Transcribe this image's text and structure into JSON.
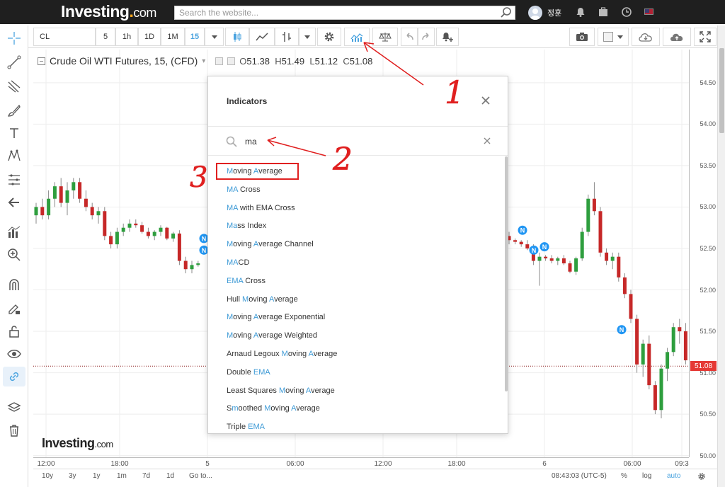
{
  "site": {
    "logo_main": "Investing",
    "logo_dot": ".",
    "logo_com": "com",
    "search_placeholder": "Search the website...",
    "username": "정훈"
  },
  "toolbar": {
    "symbol": "CL",
    "intervals": [
      "5",
      "1h",
      "1D",
      "1M",
      "15"
    ],
    "active_interval": "15"
  },
  "legend": {
    "title": "Crude Oil WTI Futures, 15, (CFD)",
    "open_label": "O",
    "open": "51.38",
    "high_label": "H",
    "high": "51.49",
    "low_label": "L",
    "low": "51.12",
    "close_label": "C",
    "close": "51.08"
  },
  "chart_data": {
    "type": "candlestick",
    "price_ticks": [
      "54.50",
      "54.00",
      "53.50",
      "53.00",
      "52.50",
      "52.00",
      "51.50",
      "51.00",
      "50.50",
      "50.00"
    ],
    "time_ticks": [
      "12:00",
      "18:00",
      "5",
      "06:00",
      "12:00",
      "18:00",
      "6",
      "06:00",
      "09:3"
    ],
    "last_price": "51.08",
    "ylim": [
      49.98,
      54.9
    ],
    "news_markers": [
      {
        "label": "N",
        "price": 52.62
      },
      {
        "label": "N",
        "price": 52.48
      },
      {
        "label": "N",
        "price": 52.72
      },
      {
        "label": "N",
        "price": 52.48
      },
      {
        "label": "N",
        "price": 52.52
      },
      {
        "label": "N",
        "price": 51.52
      }
    ],
    "candles_left": [
      [
        52.9,
        53.05,
        52.8,
        53.0
      ],
      [
        53.0,
        53.1,
        52.85,
        52.9
      ],
      [
        52.9,
        53.2,
        52.85,
        53.1
      ],
      [
        53.1,
        53.3,
        53.0,
        53.25
      ],
      [
        53.25,
        53.35,
        53.0,
        53.05
      ],
      [
        53.05,
        53.3,
        52.9,
        53.2
      ],
      [
        53.2,
        53.35,
        53.1,
        53.3
      ],
      [
        53.3,
        53.35,
        53.05,
        53.1
      ],
      [
        53.1,
        53.2,
        52.95,
        53.0
      ],
      [
        53.0,
        53.05,
        52.85,
        52.9
      ],
      [
        52.9,
        53.0,
        52.8,
        52.95
      ],
      [
        52.95,
        53.0,
        52.6,
        52.65
      ],
      [
        52.65,
        52.7,
        52.5,
        52.55
      ],
      [
        52.55,
        52.75,
        52.5,
        52.7
      ],
      [
        52.7,
        52.8,
        52.65,
        52.75
      ],
      [
        52.75,
        52.85,
        52.7,
        52.8
      ],
      [
        52.8,
        52.85,
        52.75,
        52.78
      ],
      [
        52.78,
        52.82,
        52.68,
        52.7
      ],
      [
        52.7,
        52.75,
        52.62,
        52.65
      ],
      [
        52.65,
        52.72,
        52.6,
        52.7
      ],
      [
        52.7,
        52.78,
        52.65,
        52.75
      ],
      [
        52.75,
        52.76,
        52.6,
        52.62
      ],
      [
        52.62,
        52.7,
        52.58,
        52.68
      ],
      [
        52.68,
        52.72,
        52.3,
        52.35
      ],
      [
        52.35,
        52.4,
        52.2,
        52.25
      ],
      [
        52.25,
        52.35,
        52.2,
        52.3
      ],
      [
        52.3,
        52.35,
        52.28,
        52.32
      ]
    ],
    "candles_right": [
      [
        52.65,
        52.7,
        52.55,
        52.6
      ],
      [
        52.6,
        52.62,
        52.55,
        52.58
      ],
      [
        52.58,
        52.6,
        52.52,
        52.55
      ],
      [
        52.55,
        52.6,
        52.48,
        52.5
      ],
      [
        52.5,
        52.55,
        52.3,
        52.35
      ],
      [
        52.35,
        52.45,
        52.05,
        52.4
      ],
      [
        52.4,
        52.42,
        52.35,
        52.38
      ],
      [
        52.38,
        52.42,
        52.32,
        52.35
      ],
      [
        52.35,
        52.4,
        52.3,
        52.38
      ],
      [
        52.38,
        52.42,
        52.3,
        52.32
      ],
      [
        52.32,
        52.35,
        52.2,
        52.22
      ],
      [
        52.22,
        52.4,
        52.18,
        52.38
      ],
      [
        52.38,
        52.75,
        52.35,
        52.7
      ],
      [
        52.7,
        53.15,
        52.65,
        53.1
      ],
      [
        53.1,
        53.3,
        52.9,
        52.95
      ],
      [
        52.95,
        53.0,
        52.4,
        52.45
      ],
      [
        52.45,
        52.5,
        52.3,
        52.35
      ],
      [
        52.35,
        52.45,
        52.25,
        52.4
      ],
      [
        52.4,
        52.45,
        52.1,
        52.15
      ],
      [
        52.15,
        52.2,
        51.9,
        51.95
      ],
      [
        51.95,
        52.0,
        51.6,
        51.65
      ],
      [
        51.65,
        51.7,
        51.0,
        51.1
      ],
      [
        51.1,
        51.4,
        50.95,
        51.35
      ],
      [
        51.35,
        51.45,
        50.8,
        50.85
      ],
      [
        50.85,
        50.9,
        50.5,
        50.55
      ],
      [
        50.55,
        51.1,
        50.45,
        51.05
      ],
      [
        51.05,
        51.3,
        50.9,
        51.25
      ],
      [
        51.25,
        51.6,
        51.2,
        51.55
      ],
      [
        51.55,
        51.65,
        51.35,
        51.5
      ],
      [
        51.5,
        51.6,
        51.1,
        51.15
      ],
      [
        51.15,
        51.3,
        50.75,
        50.8
      ],
      [
        50.8,
        51.45,
        50.7,
        51.4
      ],
      [
        51.4,
        51.49,
        51.05,
        51.08
      ]
    ]
  },
  "dialog": {
    "title": "Indicators",
    "search_value": "ma",
    "items": [
      {
        "parts": [
          {
            "t": "M",
            "h": true
          },
          {
            "t": "oving ",
            "h": false
          },
          {
            "t": "A",
            "h": true
          },
          {
            "t": "verage",
            "h": false
          }
        ]
      },
      {
        "parts": [
          {
            "t": "MA",
            "h": true
          },
          {
            "t": " Cross",
            "h": false
          }
        ]
      },
      {
        "parts": [
          {
            "t": "MA",
            "h": true
          },
          {
            "t": " with EMA Cross",
            "h": false
          }
        ]
      },
      {
        "parts": [
          {
            "t": "Ma",
            "h": true
          },
          {
            "t": "ss Index",
            "h": false
          }
        ]
      },
      {
        "parts": [
          {
            "t": "M",
            "h": true
          },
          {
            "t": "oving ",
            "h": false
          },
          {
            "t": "A",
            "h": true
          },
          {
            "t": "verage Channel",
            "h": false
          }
        ]
      },
      {
        "parts": [
          {
            "t": "MA",
            "h": true
          },
          {
            "t": "CD",
            "h": false
          }
        ]
      },
      {
        "parts": [
          {
            "t": "EMA",
            "h": true
          },
          {
            "t": " Cross",
            "h": false
          }
        ]
      },
      {
        "parts": [
          {
            "t": "Hull ",
            "h": false
          },
          {
            "t": "M",
            "h": true
          },
          {
            "t": "oving ",
            "h": false
          },
          {
            "t": "A",
            "h": true
          },
          {
            "t": "verage",
            "h": false
          }
        ]
      },
      {
        "parts": [
          {
            "t": "M",
            "h": true
          },
          {
            "t": "oving ",
            "h": false
          },
          {
            "t": "A",
            "h": true
          },
          {
            "t": "verage Exponential",
            "h": false
          }
        ]
      },
      {
        "parts": [
          {
            "t": "M",
            "h": true
          },
          {
            "t": "oving ",
            "h": false
          },
          {
            "t": "A",
            "h": true
          },
          {
            "t": "verage Weighted",
            "h": false
          }
        ]
      },
      {
        "parts": [
          {
            "t": "Arnaud Legoux ",
            "h": false
          },
          {
            "t": "M",
            "h": true
          },
          {
            "t": "oving ",
            "h": false
          },
          {
            "t": "A",
            "h": true
          },
          {
            "t": "verage",
            "h": false
          }
        ]
      },
      {
        "parts": [
          {
            "t": "Double ",
            "h": false
          },
          {
            "t": "EMA",
            "h": true
          }
        ]
      },
      {
        "parts": [
          {
            "t": "Least Squares ",
            "h": false
          },
          {
            "t": "M",
            "h": true
          },
          {
            "t": "oving ",
            "h": false
          },
          {
            "t": "A",
            "h": true
          },
          {
            "t": "verage",
            "h": false
          }
        ]
      },
      {
        "parts": [
          {
            "t": "S",
            "h": false
          },
          {
            "t": "m",
            "h": true
          },
          {
            "t": "oothed ",
            "h": false
          },
          {
            "t": "M",
            "h": true
          },
          {
            "t": "oving ",
            "h": false
          },
          {
            "t": "A",
            "h": true
          },
          {
            "t": "verage",
            "h": false
          }
        ]
      },
      {
        "parts": [
          {
            "t": "Triple ",
            "h": false
          },
          {
            "t": "EMA",
            "h": true
          }
        ]
      }
    ]
  },
  "bottom": {
    "ranges": [
      "10y",
      "3y",
      "1y",
      "1m",
      "7d",
      "1d"
    ],
    "goto": "Go to...",
    "time": "08:43:03 (UTC-5)",
    "percent": "%",
    "log": "log",
    "auto": "auto"
  },
  "annotations": {
    "labels": [
      "1",
      "2",
      "3"
    ],
    "color": "#e02020"
  },
  "colors": {
    "up": "#2e9e3e",
    "down": "#c62828",
    "accent": "#4aa3df",
    "news": "#2196f3"
  }
}
